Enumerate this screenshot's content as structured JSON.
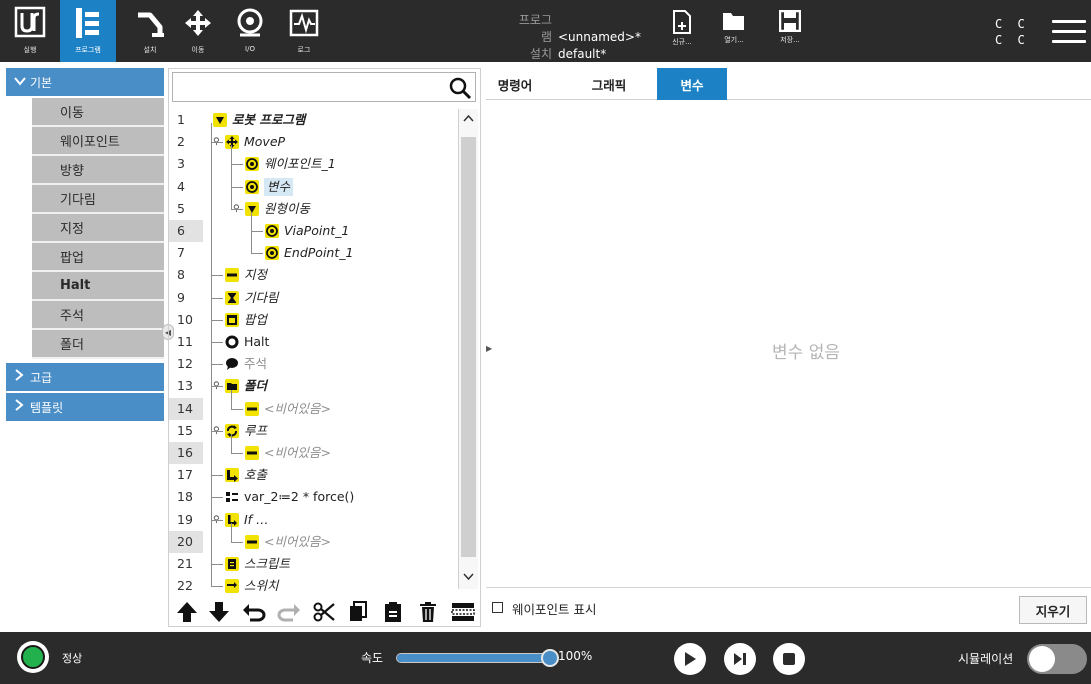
{
  "topbar": {
    "tabs": [
      {
        "label": "실행",
        "icon": "ur-logo-icon"
      },
      {
        "label": "프로그램",
        "icon": "program-tree-icon"
      },
      {
        "label": "설치",
        "icon": "robot-arm-icon"
      },
      {
        "label": "이동",
        "icon": "move-arrows-icon"
      },
      {
        "label": "I/O",
        "icon": "io-icon"
      },
      {
        "label": "로그",
        "icon": "log-icon"
      }
    ],
    "active_tab": "프로그램",
    "program_key": "프로그램",
    "program_value": "<unnamed>*",
    "install_key": "설치",
    "install_value": "default*",
    "file_new": "신규...",
    "file_open": "열기...",
    "file_save": "저장...",
    "cc_line1": "C C",
    "cc_line2": "C C"
  },
  "sidebar": {
    "basic": {
      "title": "기본",
      "items": [
        "이동",
        "웨이포인트",
        "방향",
        "기다림",
        "지정",
        "팝업",
        "Halt",
        "주석",
        "폴더"
      ]
    },
    "advanced": {
      "title": "고급"
    },
    "templates": {
      "title": "템플릿"
    }
  },
  "tree": {
    "search_value": "",
    "rows": [
      {
        "n": "1",
        "text": "로봇 프로그램"
      },
      {
        "n": "2",
        "text": "MoveP"
      },
      {
        "n": "3",
        "text": "웨이포인트_1"
      },
      {
        "n": "4",
        "text": "변수"
      },
      {
        "n": "5",
        "text": "원형이동"
      },
      {
        "n": "6",
        "text": "ViaPoint_1"
      },
      {
        "n": "7",
        "text": "EndPoint_1"
      },
      {
        "n": "8",
        "text": "지정"
      },
      {
        "n": "9",
        "text": "기다림"
      },
      {
        "n": "10",
        "text": "팝업"
      },
      {
        "n": "11",
        "text": "Halt"
      },
      {
        "n": "12",
        "text": "주석"
      },
      {
        "n": "13",
        "text": "폴더"
      },
      {
        "n": "14",
        "text": "<비어있음>"
      },
      {
        "n": "15",
        "text": "루프"
      },
      {
        "n": "16",
        "text": "<비어있음>"
      },
      {
        "n": "17",
        "text": "호출"
      },
      {
        "n": "18",
        "text": "var_2≔2 * force()"
      },
      {
        "n": "19",
        "text": "If …"
      },
      {
        "n": "20",
        "text": "<비어있음>"
      },
      {
        "n": "21",
        "text": "스크립트"
      },
      {
        "n": "22",
        "text": "스위치"
      }
    ]
  },
  "right": {
    "tabs": [
      "명령어",
      "그래픽",
      "변수"
    ],
    "active_tab": "변수",
    "empty_message": "변수 없음",
    "show_waypoints_label": "웨이포인트 표시",
    "show_waypoints_checked": false,
    "clear_button": "지우기"
  },
  "bottombar": {
    "status": "정상",
    "status_color": "#22b14c",
    "speed_label": "속도",
    "speed_percent": 100,
    "speed_text": "100%",
    "simulation_label": "시뮬레이션",
    "simulation_on": false
  },
  "colors": {
    "accent": "#1d82c5",
    "sidebar_head": "#4a8ec8",
    "node_yellow": "#f2e200",
    "bar_bg": "#2b2b2b"
  }
}
